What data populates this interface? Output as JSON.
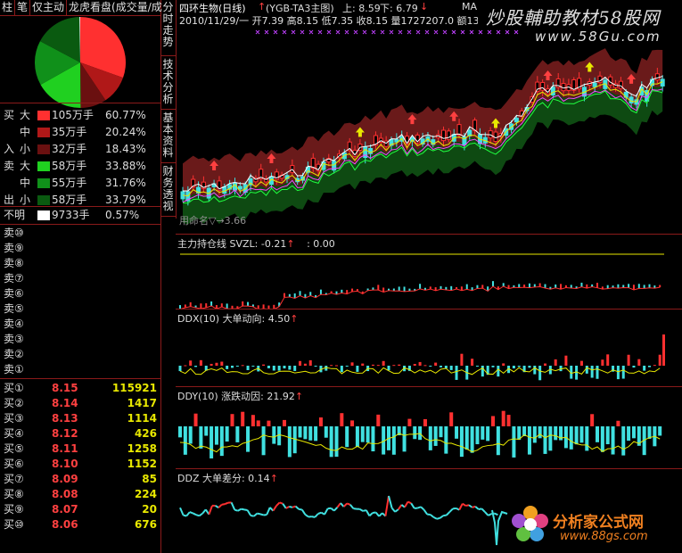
{
  "left_tabs": [
    "柱",
    "笔",
    "仅主动",
    "龙虎看盘(成交量/成"
  ],
  "flow": {
    "buy_label_top": "买",
    "buy_label_bottom": "入",
    "sell_label_top": "卖",
    "sell_label_bottom": "出",
    "rows": [
      {
        "size": "大",
        "volume": "105万手",
        "pct": "60.77%",
        "color": "#ff3030"
      },
      {
        "size": "中",
        "volume": "35万手",
        "pct": "20.24%",
        "color": "#b01818"
      },
      {
        "size": "小",
        "volume": "32万手",
        "pct": "18.43%",
        "color": "#6a1010"
      },
      {
        "size": "大",
        "volume": "58万手",
        "pct": "33.88%",
        "color": "#20d020"
      },
      {
        "size": "中",
        "volume": "55万手",
        "pct": "31.76%",
        "color": "#10901a"
      },
      {
        "size": "小",
        "volume": "58万手",
        "pct": "33.79%",
        "color": "#0a5a10"
      }
    ],
    "unknown": {
      "label": "不明",
      "volume": "9733手",
      "pct": "0.57%",
      "color": "#ffffff"
    }
  },
  "order_book": {
    "sell": [
      "卖⑩",
      "卖⑨",
      "卖⑧",
      "卖⑦",
      "卖⑥",
      "卖⑤",
      "卖④",
      "卖③",
      "卖②",
      "卖①"
    ],
    "buy": [
      {
        "label": "买①",
        "price": "8.15",
        "qty": "115921"
      },
      {
        "label": "买②",
        "price": "8.14",
        "qty": "1417"
      },
      {
        "label": "买③",
        "price": "8.13",
        "qty": "1114"
      },
      {
        "label": "买④",
        "price": "8.12",
        "qty": "426"
      },
      {
        "label": "买⑤",
        "price": "8.11",
        "qty": "1258"
      },
      {
        "label": "买⑥",
        "price": "8.10",
        "qty": "1152"
      },
      {
        "label": "买⑦",
        "price": "8.09",
        "qty": "85"
      },
      {
        "label": "买⑧",
        "price": "8.08",
        "qty": "224"
      },
      {
        "label": "买⑨",
        "price": "8.07",
        "qty": "20"
      },
      {
        "label": "买⑩",
        "price": "8.06",
        "qty": "676"
      }
    ]
  },
  "vertical_tabs": [
    "分时走势",
    "技术分析",
    "基本资料",
    "财务透视"
  ],
  "main_chart": {
    "title": "四环生物(日线)",
    "formula": "(YGB-TA3主图)",
    "up_label": "上: 8.59",
    "down_label": "下: 6.79",
    "ma_label": "MA",
    "ohlc": "2010/11/29/一 开7.39 高8.15 低7.35 收8.15 量1727207.0 额13",
    "bottom_label": "用命名▽→3.66",
    "watermark": "炒股輔助教材58股网",
    "watermark_url": "www.58Gu.com"
  },
  "indicators": [
    {
      "name": "主力持仓线",
      "text": "SVZL: -0.21",
      "extra": ": 0.00"
    },
    {
      "name": "DDX(10)",
      "text": "大单动向: 4.50"
    },
    {
      "name": "DDY(10)",
      "text": "涨跌动因: 21.92"
    },
    {
      "name": "DDZ",
      "text": "大单差分: 0.14"
    }
  ],
  "brand": {
    "name": "分析家公式网",
    "url": "www.88gs.com"
  },
  "colors": {
    "border": "#8a1a1a",
    "up": "#ff3030",
    "down": "#40e0e0",
    "yellow": "#e8e800"
  }
}
